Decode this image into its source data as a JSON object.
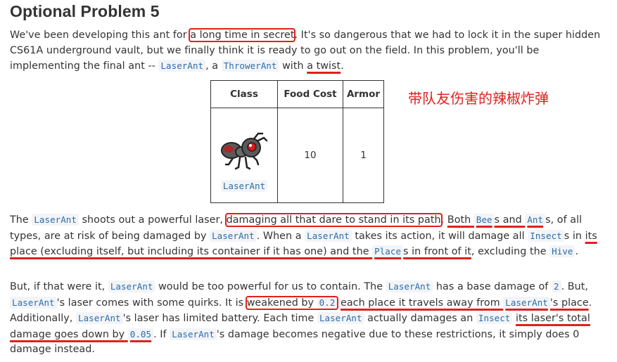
{
  "title": "Optional Problem 5",
  "intro": {
    "t1": "We've been developing this ant for ",
    "t2": "a long time in secret",
    "t3": ". It's so dangerous that we had to lock it in the super hidden CS61A underground vault, but we finally think it is ready to go out on the field. In this problem, you'll be implementing the final ant -- ",
    "c1": "LaserAnt",
    "t4": ", a ",
    "c2": "ThrowerAnt",
    "t5": " with ",
    "t6": "a twist",
    "t7": "."
  },
  "table": {
    "headers": [
      "Class",
      "Food Cost",
      "Armor"
    ],
    "row": {
      "class_label": "LaserAnt",
      "food_cost": "10",
      "armor": "1"
    }
  },
  "annotation": "带队友伤害的辣椒炸弹",
  "p2": {
    "t1": "The ",
    "c1": "LaserAnt",
    "t2": " shoots out a powerful laser, ",
    "t3": "damaging all that dare to stand in its path",
    "t4": ". ",
    "t5": "Both ",
    "c2": "Bee",
    "t6": "s and ",
    "c3": "Ant",
    "t7": "s",
    "t8": ", of all types, are at risk of being damaged by ",
    "c4": "LaserAnt",
    "t9": ". When a ",
    "c5": "LaserAnt",
    "t10": " takes its action, it will damage all ",
    "c6": "Insect",
    "t11": "s in ",
    "t12": "its place (excluding itself, but including its container if it has one) and the ",
    "c7": "Place",
    "t13": "s in front of it",
    "t14": ", excluding the ",
    "c8": "Hive",
    "t15": "."
  },
  "p3": {
    "t1": "But, if that were it, ",
    "c1": "LaserAnt",
    "t2": " would be too powerful for us to contain. The ",
    "c2": "LaserAnt",
    "t3": " has a base damage of ",
    "c3": "2",
    "t4": ". But, ",
    "c4": "LaserAnt",
    "t5": "'s laser comes with some quirks. It is ",
    "t6": "weakened by ",
    "c5": "0.2",
    "t7": " ",
    "t8": "each place it travels away from ",
    "c6": "LaserAnt",
    "t9": "'s place",
    "t10": ". Additionally, ",
    "c7": "LaserAnt",
    "t11": "'s laser has limited battery. Each time ",
    "c8": "LaserAnt",
    "t12": " actually damages an ",
    "c9": "Insect",
    "t13": " ",
    "t14": "its laser's total damage goes down by ",
    "c10": "0.05",
    "t15": ". If ",
    "c11": "LaserAnt",
    "t16": "'s damage becomes negative due to these restrictions, it simply does 0 damage instead."
  },
  "colors": {
    "annotation": "#e0201d",
    "code": "#2b6da8",
    "code_bg": "#f2f4f7",
    "text": "#333333"
  },
  "icons": {
    "ant": "laser-ant-icon"
  }
}
